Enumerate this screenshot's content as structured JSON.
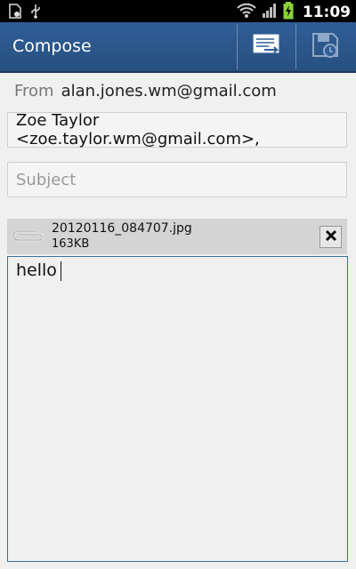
{
  "status_bar": {
    "time": "11:09",
    "icons": [
      "file-settings-icon",
      "usb-icon",
      "wifi-icon",
      "signal-icon",
      "battery-charging-icon"
    ]
  },
  "action_bar": {
    "title": "Compose",
    "send_icon": "send-mail-icon",
    "save_icon": "save-draft-icon"
  },
  "compose": {
    "from_label": "From",
    "from_address": "alan.jones.wm@gmail.com",
    "to_value": "Zoe Taylor <zoe.taylor.wm@gmail.com>,",
    "subject_placeholder": "Subject",
    "subject_value": "",
    "attachment": {
      "filename": "20120116_084707.jpg",
      "size": "163KB",
      "remove_icon": "close-icon"
    },
    "body_text": "hello"
  },
  "colors": {
    "action_bar": "#2f5e97",
    "status_bar": "#000000",
    "background": "#f0f0f0",
    "body_border": "#3b6fa3"
  }
}
